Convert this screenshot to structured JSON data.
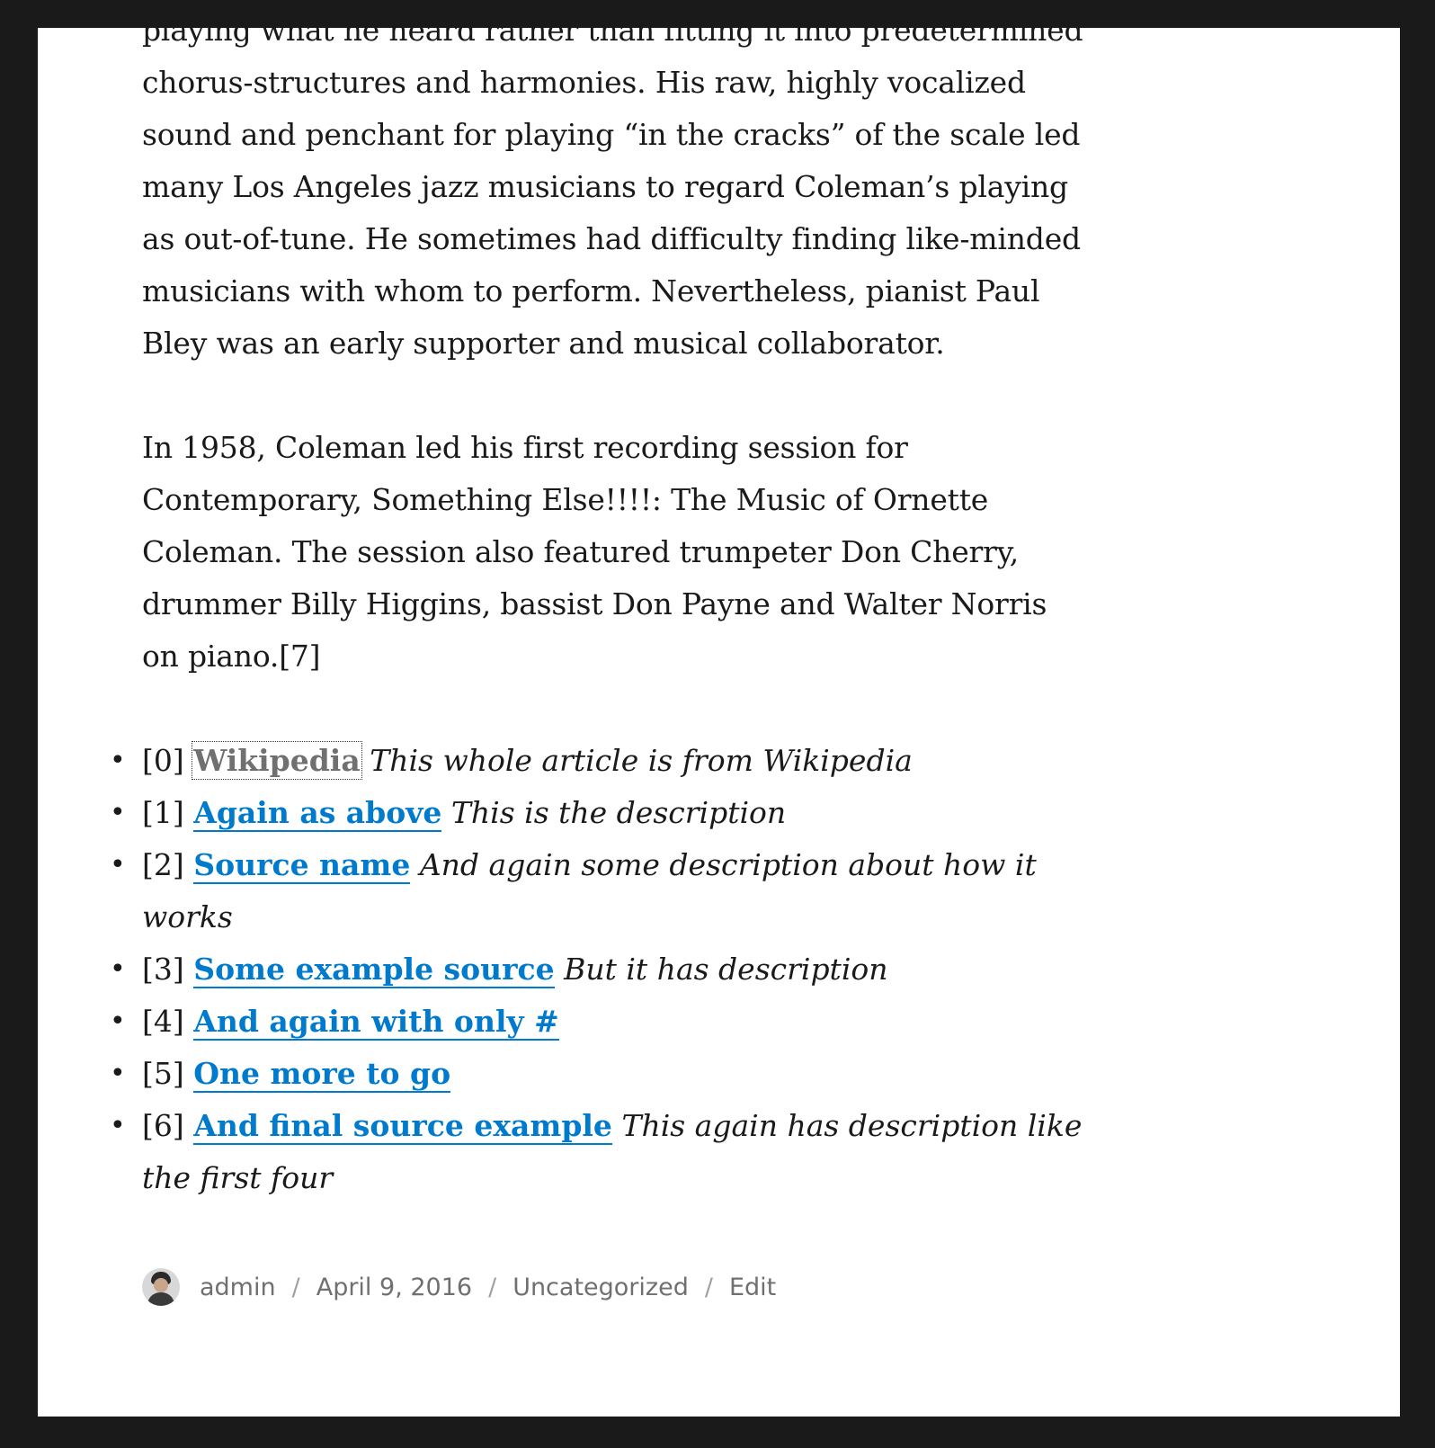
{
  "article": {
    "paragraph1": "playing what he heard rather than fitting it into predetermined chorus-structures and harmonies. His raw, highly vocalized sound and penchant for playing “in the cracks” of the scale led many Los Angeles jazz musicians to regard Coleman’s playing as out-of-tune. He sometimes had difficulty finding like-minded musicians with whom to perform. Nevertheless, pianist Paul Bley was an early supporter and musical collaborator.",
    "paragraph2": "In 1958, Coleman led his first recording session for Contemporary, Something Else!!!!: The Music of Ornette Coleman. The session also featured trumpeter Don Cherry, drummer Billy Higgins, bassist Don Payne and Walter Norris on piano.[7]"
  },
  "references": [
    {
      "num": "[0]",
      "title": "Wikipedia",
      "description": "This whole article is from Wikipedia"
    },
    {
      "num": "[1]",
      "title": "Again as above",
      "description": "This is the description"
    },
    {
      "num": "[2]",
      "title": "Source name",
      "description": "And again some description about how it works"
    },
    {
      "num": "[3]",
      "title": "Some example source",
      "description": "But it has description"
    },
    {
      "num": "[4]",
      "title": "And again with only #",
      "description": ""
    },
    {
      "num": "[5]",
      "title": "One more to go",
      "description": ""
    },
    {
      "num": "[6]",
      "title": "And final source example",
      "description": "This again has description like the first four"
    }
  ],
  "bullet": "•",
  "meta": {
    "author": "admin",
    "date": "April 9, 2016",
    "category": "Uncategorized",
    "edit": "Edit",
    "separator": "/"
  },
  "colors": {
    "link": "#007acc",
    "visited_link": "#707070",
    "meta_text": "#707070",
    "background": "#1a1a1a",
    "page": "#ffffff"
  }
}
